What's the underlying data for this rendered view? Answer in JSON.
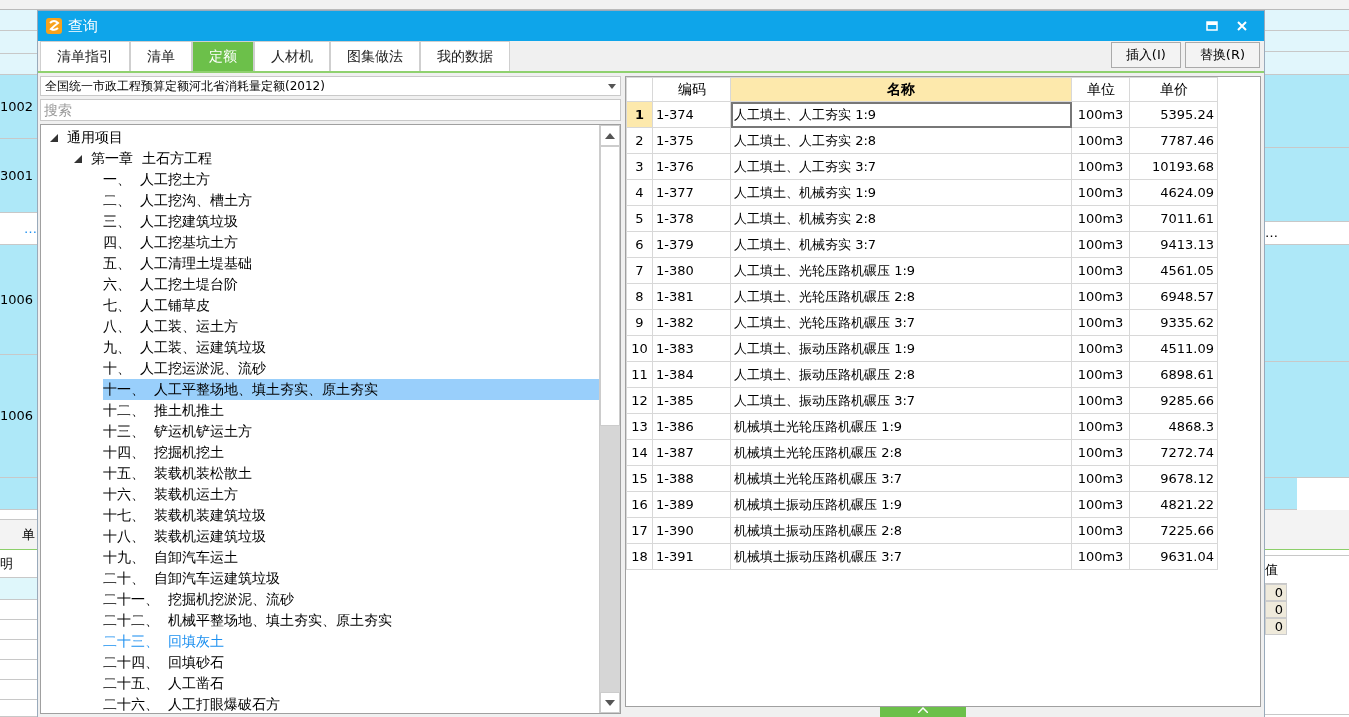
{
  "background": {
    "left_codes": [
      "1002",
      "3001",
      "1006",
      "1006"
    ],
    "left_ellipsis": "…",
    "left_tab": "单",
    "left_column_header": "明",
    "right_ellipsis": "…",
    "right_column_header": "值",
    "right_values": [
      "0",
      "0",
      "0"
    ]
  },
  "dialog": {
    "title": "查询",
    "tabs": [
      {
        "label": "清单指引",
        "selected": false
      },
      {
        "label": "清单",
        "selected": false
      },
      {
        "label": "定额",
        "selected": true
      },
      {
        "label": "人材机",
        "selected": false
      },
      {
        "label": "图集做法",
        "selected": false
      },
      {
        "label": "我的数据",
        "selected": false
      }
    ],
    "buttons": [
      "插入(I)",
      "替换(R)"
    ],
    "library": "全国统一市政工程预算定额河北省消耗量定额(2012)",
    "search": {
      "placeholder": "搜索"
    },
    "tree": [
      {
        "label": "通用项目",
        "expanded": true,
        "selected": false,
        "highlighted": false,
        "children": [
          {
            "label": "第一章  土石方工程",
            "expanded": true,
            "selected": false,
            "highlighted": false,
            "children": [
              {
                "label": "一、  人工挖土方",
                "selected": false,
                "highlighted": false
              },
              {
                "label": "二、  人工挖沟、槽土方",
                "selected": false,
                "highlighted": false
              },
              {
                "label": "三、  人工挖建筑垃圾",
                "selected": false,
                "highlighted": false
              },
              {
                "label": "四、  人工挖基坑土方",
                "selected": false,
                "highlighted": false
              },
              {
                "label": "五、  人工清理土堤基础",
                "selected": false,
                "highlighted": false
              },
              {
                "label": "六、  人工挖土堤台阶",
                "selected": false,
                "highlighted": false
              },
              {
                "label": "七、  人工铺草皮",
                "selected": false,
                "highlighted": false
              },
              {
                "label": "八、  人工装、运土方",
                "selected": false,
                "highlighted": false
              },
              {
                "label": "九、  人工装、运建筑垃圾",
                "selected": false,
                "highlighted": false
              },
              {
                "label": "十、  人工挖运淤泥、流砂",
                "selected": false,
                "highlighted": false
              },
              {
                "label": "十一、  人工平整场地、填土夯实、原土夯实",
                "selected": true,
                "highlighted": false
              },
              {
                "label": "十二、  推土机推土",
                "selected": false,
                "highlighted": false
              },
              {
                "label": "十三、  铲运机铲运土方",
                "selected": false,
                "highlighted": false
              },
              {
                "label": "十四、  挖掘机挖土",
                "selected": false,
                "highlighted": false
              },
              {
                "label": "十五、  装载机装松散土",
                "selected": false,
                "highlighted": false
              },
              {
                "label": "十六、  装载机运土方",
                "selected": false,
                "highlighted": false
              },
              {
                "label": "十七、  装载机装建筑垃圾",
                "selected": false,
                "highlighted": false
              },
              {
                "label": "十八、  装载机运建筑垃圾",
                "selected": false,
                "highlighted": false
              },
              {
                "label": "十九、  自卸汽车运土",
                "selected": false,
                "highlighted": false
              },
              {
                "label": "二十、  自卸汽车运建筑垃圾",
                "selected": false,
                "highlighted": false
              },
              {
                "label": "二十一、  挖掘机挖淤泥、流砂",
                "selected": false,
                "highlighted": false
              },
              {
                "label": "二十二、  机械平整场地、填土夯实、原土夯实",
                "selected": false,
                "highlighted": false
              },
              {
                "label": "二十三、  回填灰土",
                "selected": false,
                "highlighted": true
              },
              {
                "label": "二十四、  回填砂石",
                "selected": false,
                "highlighted": false
              },
              {
                "label": "二十五、  人工凿石",
                "selected": false,
                "highlighted": false
              },
              {
                "label": "二十六、  人工打眼爆破石方",
                "selected": false,
                "highlighted": false
              }
            ]
          }
        ]
      }
    ],
    "table": {
      "columns": [
        {
          "label": "编码",
          "selected": false
        },
        {
          "label": "名称",
          "selected": true
        },
        {
          "label": "单位",
          "selected": false
        },
        {
          "label": "单价",
          "selected": false
        }
      ],
      "rows": [
        {
          "no": "1",
          "code": "1-374",
          "name": "人工填土、人工夯实 1:9",
          "unit": "100m3",
          "price": "5395.24",
          "selected": true
        },
        {
          "no": "2",
          "code": "1-375",
          "name": "人工填土、人工夯实 2:8",
          "unit": "100m3",
          "price": "7787.46",
          "selected": false
        },
        {
          "no": "3",
          "code": "1-376",
          "name": "人工填土、人工夯实 3:7",
          "unit": "100m3",
          "price": "10193.68",
          "selected": false
        },
        {
          "no": "4",
          "code": "1-377",
          "name": "人工填土、机械夯实 1:9",
          "unit": "100m3",
          "price": "4624.09",
          "selected": false
        },
        {
          "no": "5",
          "code": "1-378",
          "name": "人工填土、机械夯实 2:8",
          "unit": "100m3",
          "price": "7011.61",
          "selected": false
        },
        {
          "no": "6",
          "code": "1-379",
          "name": "人工填土、机械夯实 3:7",
          "unit": "100m3",
          "price": "9413.13",
          "selected": false
        },
        {
          "no": "7",
          "code": "1-380",
          "name": "人工填土、光轮压路机碾压 1:9",
          "unit": "100m3",
          "price": "4561.05",
          "selected": false
        },
        {
          "no": "8",
          "code": "1-381",
          "name": "人工填土、光轮压路机碾压 2:8",
          "unit": "100m3",
          "price": "6948.57",
          "selected": false
        },
        {
          "no": "9",
          "code": "1-382",
          "name": "人工填土、光轮压路机碾压 3:7",
          "unit": "100m3",
          "price": "9335.62",
          "selected": false
        },
        {
          "no": "10",
          "code": "1-383",
          "name": "人工填土、振动压路机碾压 1:9",
          "unit": "100m3",
          "price": "4511.09",
          "selected": false
        },
        {
          "no": "11",
          "code": "1-384",
          "name": "人工填土、振动压路机碾压 2:8",
          "unit": "100m3",
          "price": "6898.61",
          "selected": false
        },
        {
          "no": "12",
          "code": "1-385",
          "name": "人工填土、振动压路机碾压 3:7",
          "unit": "100m3",
          "price": "9285.66",
          "selected": false
        },
        {
          "no": "13",
          "code": "1-386",
          "name": "机械填土光轮压路机碾压 1:9",
          "unit": "100m3",
          "price": "4868.3",
          "selected": false
        },
        {
          "no": "14",
          "code": "1-387",
          "name": "机械填土光轮压路机碾压 2:8",
          "unit": "100m3",
          "price": "7272.74",
          "selected": false
        },
        {
          "no": "15",
          "code": "1-388",
          "name": "机械填土光轮压路机碾压 3:7",
          "unit": "100m3",
          "price": "9678.12",
          "selected": false
        },
        {
          "no": "16",
          "code": "1-389",
          "name": "机械填土振动压路机碾压 1:9",
          "unit": "100m3",
          "price": "4821.22",
          "selected": false
        },
        {
          "no": "17",
          "code": "1-390",
          "name": "机械填土振动压路机碾压 2:8",
          "unit": "100m3",
          "price": "7225.66",
          "selected": false
        },
        {
          "no": "18",
          "code": "1-391",
          "name": "机械填土振动压路机碾压 3:7",
          "unit": "100m3",
          "price": "9631.04",
          "selected": false
        }
      ]
    }
  }
}
